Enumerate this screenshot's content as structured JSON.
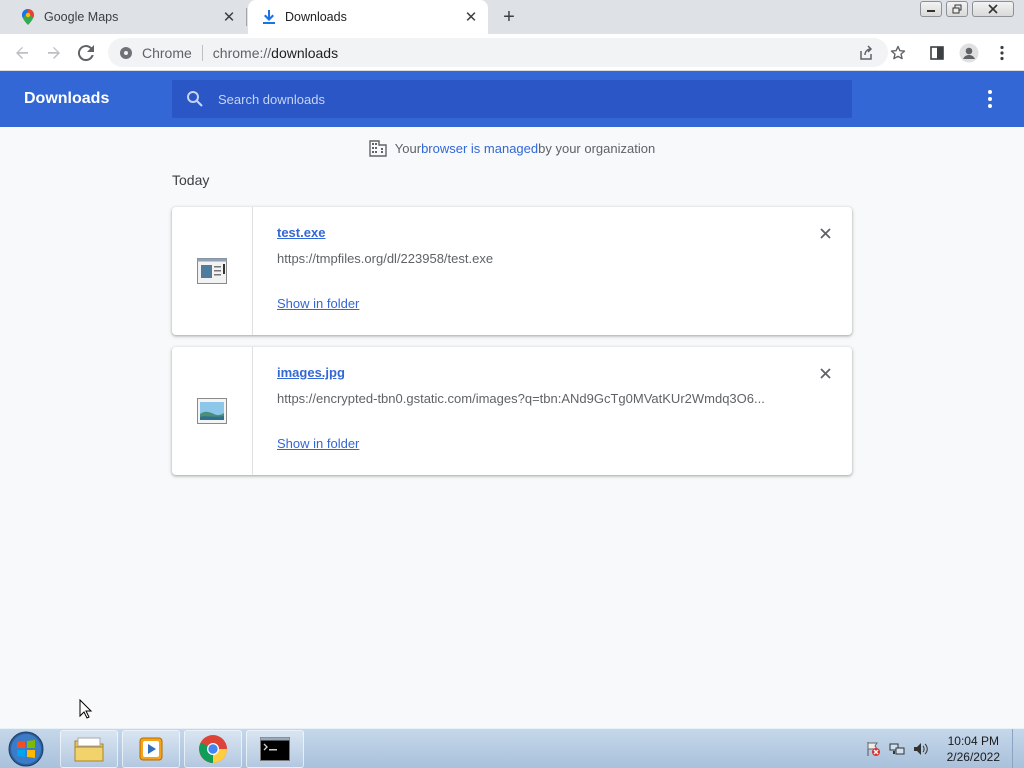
{
  "browser": {
    "tabs": [
      {
        "title": "Google Maps",
        "active": false,
        "icon": "maps-pin-icon"
      },
      {
        "title": "Downloads",
        "active": true,
        "icon": "download-arrow-icon"
      }
    ],
    "omnibox": {
      "chip": "Chrome",
      "scheme": "chrome://",
      "path": "downloads"
    }
  },
  "downloads": {
    "title": "Downloads",
    "search_placeholder": "Search downloads",
    "managed": {
      "prefix": "Your ",
      "link": "browser is managed",
      "suffix": " by your organization"
    },
    "section_label": "Today",
    "items": [
      {
        "filename": "test.exe",
        "url": "https://tmpfiles.org/dl/223958/test.exe",
        "action": "Show in folder",
        "icon": "executable-file-icon"
      },
      {
        "filename": "images.jpg",
        "url": "https://encrypted-tbn0.gstatic.com/images?q=tbn:ANd9GcTg0MVatKUr2Wmdq3O6...",
        "action": "Show in folder",
        "icon": "image-file-icon"
      }
    ]
  },
  "taskbar": {
    "clock_time": "10:04 PM",
    "clock_date": "2/26/2022"
  },
  "colors": {
    "accent": "#3367d6",
    "header_search": "#2a56c6"
  }
}
